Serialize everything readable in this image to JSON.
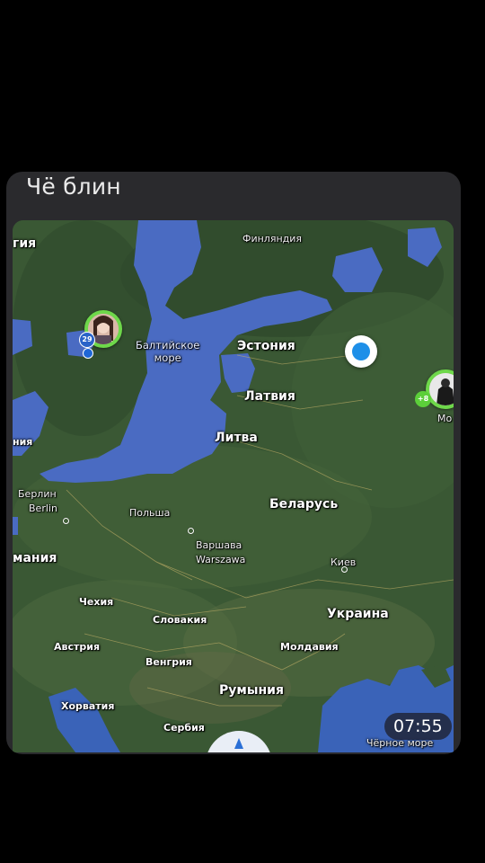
{
  "card": {
    "title": "Чё блин"
  },
  "map": {
    "labels": {
      "finland": "Финляндия",
      "sweden_partial": "гия",
      "baltic_sea_1": "Балтийское",
      "baltic_sea_2": "море",
      "estonia": "Эстония",
      "latvia": "Латвия",
      "lithuania": "Литва",
      "nia_partial": "ния",
      "berlin_ru": "Берлин",
      "berlin_en": "Berlin",
      "poland": "Польша",
      "belarus": "Беларусь",
      "warsaw_ru": "Варшава",
      "warsaw_en": "Warszawa",
      "germany_partial": "мания",
      "kiev": "Киев",
      "czechia": "Чехия",
      "slovakia": "Словакия",
      "ukraine": "Украина",
      "austria": "Австрия",
      "hungary": "Венгрия",
      "moldova": "Молдавия",
      "romania": "Румыния",
      "croatia": "Хорватия",
      "serbia": "Сербия",
      "black_sea": "Чёрное море",
      "moscow_partial": "Мо"
    },
    "friend_badge": "29",
    "friend_badge2": "+8"
  },
  "clock": "07:55"
}
